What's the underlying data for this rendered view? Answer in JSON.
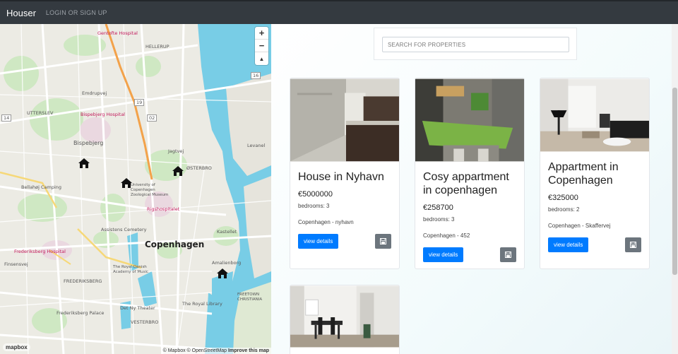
{
  "nav": {
    "brand": "Houser",
    "login_link": "LOGIN OR SIGN UP"
  },
  "map": {
    "city_label": "Copenhagen",
    "labels": {
      "hellerup": "HELLERUP",
      "emdrupvej": "Emdrupvej",
      "bispebjerg_hospital": "Bispebjerg Hospital",
      "bispebjerg": "Bispebjerg",
      "utterslev": "UTTERSLEV",
      "osterbro": "ØSTERBRO",
      "bellahoj": "Bellahøj Camping",
      "rigshospitalet": "Rigshospitalet",
      "zoological": "University of Copenhagen Zoological Museum",
      "assistens": "Assistens Cemetery",
      "frederiksberg_hospital": "Frederiksberg Hospital",
      "finsensvej": "Finsensvej",
      "royal_danish": "The Royal Danish Academy of Music",
      "frederiksberg": "FREDERIKSBERG",
      "det_ny": "Det Ny Theater",
      "royal_library": "The Royal Library",
      "frederiksberg_palace": "Frederiksberg Palace",
      "vesterbro": "VESTERBRO",
      "christiania": "FREETOWN CHRISTIANIA",
      "kastellet": "Kastellet",
      "amalienborg": "Amalienborg",
      "levanel": "Levanel",
      "dentofte": "Gentofte Hospital",
      "jagtvej": "Jagtvej",
      "road_19": "19",
      "road_02": "02",
      "road_14": "14",
      "road_16": "16"
    },
    "zoom_in": "+",
    "zoom_out": "−",
    "compass": "▲",
    "logo": "mapbox",
    "attribution": "© Mapbox © OpenStreetMap",
    "improve": "Improve this map",
    "marker_icon": "house-icon"
  },
  "search": {
    "placeholder": "SEARCH FOR PROPERTIES"
  },
  "listings": [
    {
      "title": "House in Nyhavn",
      "price": "€5000000",
      "bedrooms": "bedrooms: 3",
      "location": "Copenhagen - nyhavn",
      "details_label": "view details",
      "save_icon": "save-icon"
    },
    {
      "title": "Cosy appartment in copenhagen",
      "price": "€258700",
      "bedrooms": "bedrooms: 3",
      "location": "Copenhagen - 452",
      "details_label": "view details",
      "save_icon": "save-icon"
    },
    {
      "title": "Appartment in Copenhagen",
      "price": "€325000",
      "bedrooms": "bedrooms: 2",
      "location": "Copenhagen - Skaffervej",
      "details_label": "view details",
      "save_icon": "save-icon"
    },
    {
      "title": "",
      "price": "",
      "bedrooms": "",
      "location": ""
    }
  ],
  "colors": {
    "navbar": "#343a40",
    "primary": "#007bff",
    "secondary": "#6c757d",
    "water": "#7dd0e8",
    "park": "#cfe8c3"
  }
}
